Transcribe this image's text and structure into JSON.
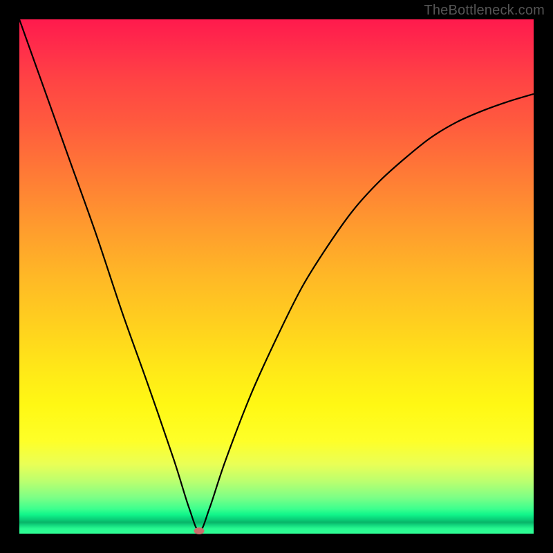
{
  "watermark": "TheBottleneck.com",
  "colors": {
    "background": "#000000",
    "curve": "#000000",
    "marker": "#cb6f6d"
  },
  "chart_data": {
    "type": "line",
    "title": "",
    "xlabel": "",
    "ylabel": "",
    "xlim": [
      0,
      100
    ],
    "ylim": [
      0,
      100
    ],
    "gradient_stops": [
      {
        "pos": 0,
        "color": "#ff1a4d"
      },
      {
        "pos": 50,
        "color": "#ffb826"
      },
      {
        "pos": 82,
        "color": "#feff28"
      },
      {
        "pos": 95,
        "color": "#3cff8e"
      },
      {
        "pos": 100,
        "color": "#30ff96"
      }
    ],
    "curve": {
      "description": "V-shaped bottleneck curve plotted over vertical red-yellow-green gradient; minimum (optimal) near x≈35",
      "x": [
        0,
        5,
        10,
        15,
        20,
        25,
        30,
        33,
        35,
        37,
        40,
        45,
        50,
        55,
        60,
        65,
        70,
        75,
        80,
        85,
        90,
        95,
        100
      ],
      "y": [
        100,
        86,
        72,
        58,
        43,
        29,
        14.5,
        5,
        0.5,
        5,
        14,
        27,
        38,
        48,
        56,
        63,
        68.5,
        73,
        77,
        80,
        82.2,
        84,
        85.5
      ]
    },
    "marker": {
      "x": 35,
      "y": 0.5
    },
    "annotations": []
  }
}
